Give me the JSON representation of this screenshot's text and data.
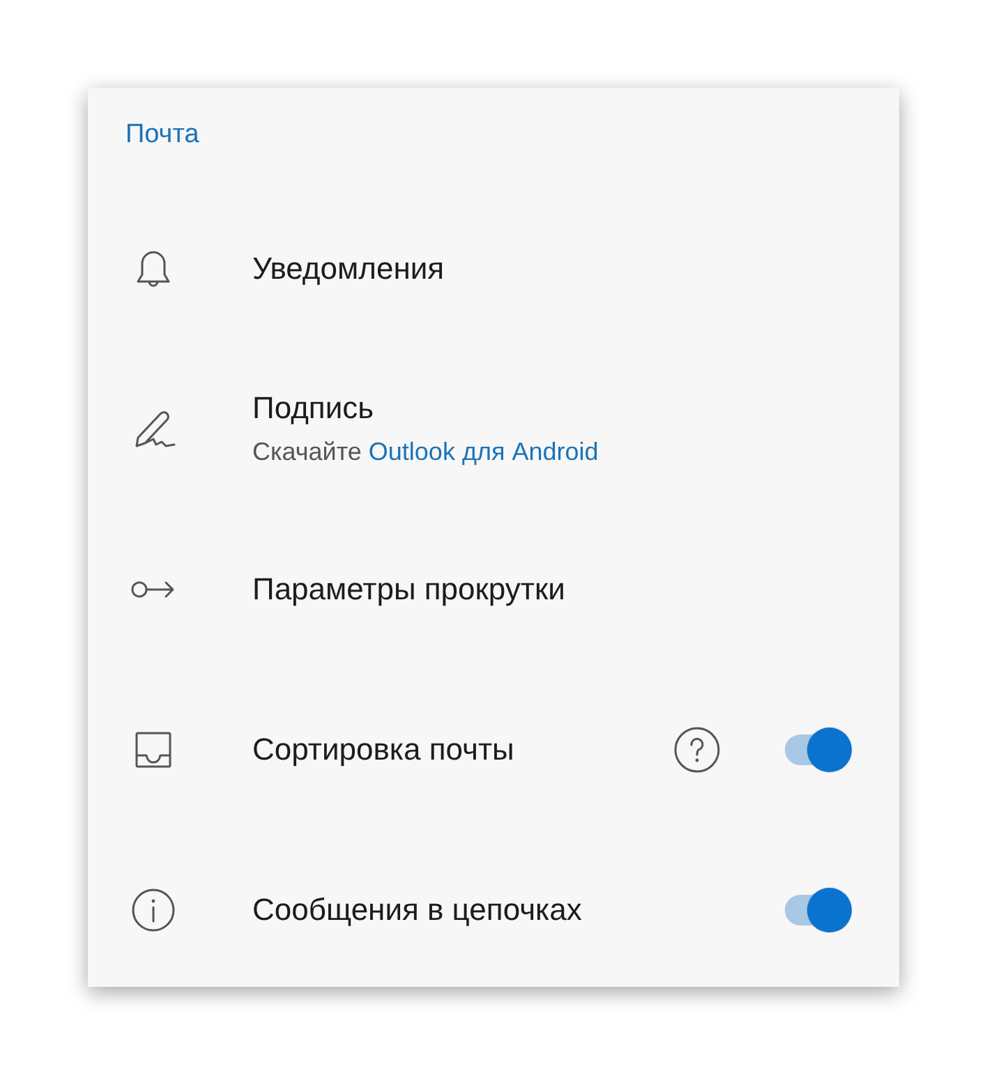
{
  "section": {
    "title": "Почта"
  },
  "rows": [
    {
      "kind": "link",
      "label": "Уведомления"
    },
    {
      "kind": "link",
      "label": "Подпись",
      "subtitle": {
        "text": "Скачайте",
        "link": "Outlook для Android"
      }
    },
    {
      "kind": "link",
      "label": "Параметры прокрутки"
    },
    {
      "kind": "toggle",
      "label": "Сортировка почты",
      "help": true,
      "on": true
    },
    {
      "kind": "toggle",
      "label": "Сообщения в цепочках",
      "help": false,
      "on": true
    }
  ]
}
